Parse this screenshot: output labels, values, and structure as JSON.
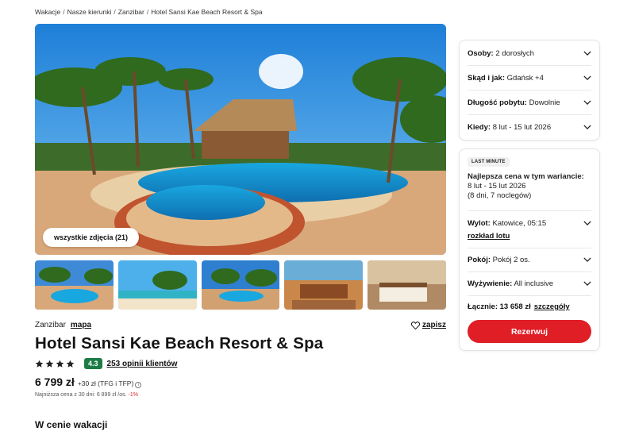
{
  "breadcrumb": [
    "Wakacje",
    "Nasze kierunki",
    "Zanzibar",
    "Hotel Sansi Kae Beach Resort & Spa"
  ],
  "gallery": {
    "all_photos_label": "wszystkie zdjęcia (21)",
    "thumbnail_count": 5
  },
  "hotel": {
    "region": "Zanzibar",
    "map_link": "mapa",
    "save_label": "zapisz",
    "name": "Hotel Sansi Kae Beach Resort & Spa",
    "stars": 4,
    "score": "4.3",
    "reviews_link": "253 opinii klientów",
    "price": "6 799 zł",
    "price_extra": "+30 zł (TFG i TFP)",
    "lowest_price_note": "Najniższa cena z 30 dni: 6 899 zł /os.",
    "lowest_price_change": "-1%"
  },
  "section_title": "W cenie wakacji",
  "filters": [
    {
      "label": "Osoby:",
      "value": "2 dorosłych"
    },
    {
      "label": "Skąd i jak:",
      "value": "Gdańsk +4"
    },
    {
      "label": "Długość pobytu:",
      "value": "Dowolnie"
    },
    {
      "label": "Kiedy:",
      "value": "8 lut - 15 lut 2026"
    }
  ],
  "offer": {
    "badge": "LAST MINUTE",
    "best_title": "Najlepsza cena w tym wariancie:",
    "best_dates": "8 lut - 15 lut 2026",
    "best_duration": "(8 dni, 7 noclegów)",
    "flight_label": "Wylot:",
    "flight_value": "Katowice, 05:15",
    "flight_link": "rozkład lotu",
    "room_label": "Pokój:",
    "room_value": "Pokój 2 os.",
    "board_label": "Wyżywienie:",
    "board_value": "All inclusive",
    "total_label": "Łącznie: 13 658 zł",
    "details_link": "szczegóły",
    "book_button": "Rezerwuj"
  },
  "colors": {
    "brand_red": "#e01e26",
    "score_green": "#1d7c46",
    "discount_red": "#d42a2a"
  },
  "icons": [
    "heart-icon",
    "star-icon",
    "chevron-down-icon",
    "info-icon"
  ]
}
